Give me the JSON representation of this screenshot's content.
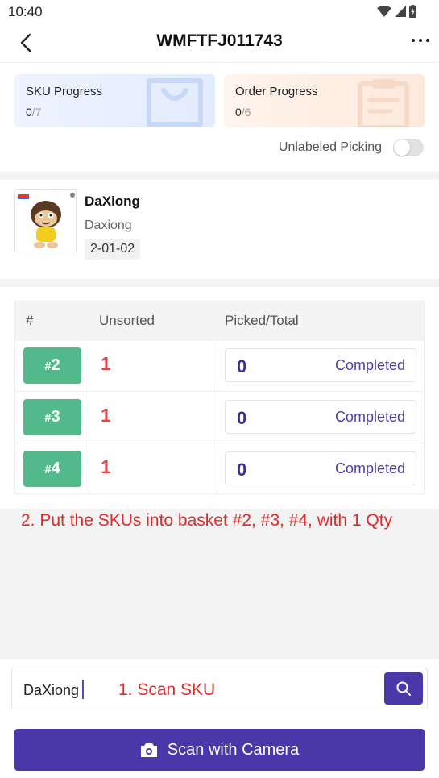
{
  "status_bar": {
    "time": "10:40"
  },
  "header": {
    "title": "WMFTFJ011743"
  },
  "progress": {
    "sku": {
      "label": "SKU Progress",
      "current": "0",
      "total": "/7"
    },
    "order": {
      "label": "Order Progress",
      "current": "0",
      "total": "/6"
    }
  },
  "unlabeled": {
    "label": "Unlabeled Picking",
    "enabled": false
  },
  "product": {
    "name": "DaXiong",
    "subtitle": "Daxiong",
    "location": "2-01-02"
  },
  "table": {
    "headers": [
      "#",
      "Unsorted",
      "Picked/Total"
    ],
    "rows": [
      {
        "hash": "#",
        "basket": "2",
        "unsorted": "1",
        "picked": "0",
        "action": "Completed"
      },
      {
        "hash": "#",
        "basket": "3",
        "unsorted": "1",
        "picked": "0",
        "action": "Completed"
      },
      {
        "hash": "#",
        "basket": "4",
        "unsorted": "1",
        "picked": "0",
        "action": "Completed"
      }
    ]
  },
  "instruction": "2. Put the SKUs into basket #2, #3, #4, with 1 Qty",
  "scan": {
    "value": "DaXiong",
    "hint": "1. Scan SKU"
  },
  "camera_button": {
    "label": "Scan with Camera"
  },
  "colors": {
    "primary": "#4a37a8",
    "basket_green": "#52b98a",
    "alert_red": "#e04646",
    "annotation_red": "#e02a2a"
  },
  "icons": [
    "wifi-icon",
    "signal-icon",
    "battery-icon",
    "back-arrow-icon",
    "more-icon",
    "shopping-bag-icon",
    "clipboard-icon",
    "search-icon",
    "camera-icon"
  ]
}
